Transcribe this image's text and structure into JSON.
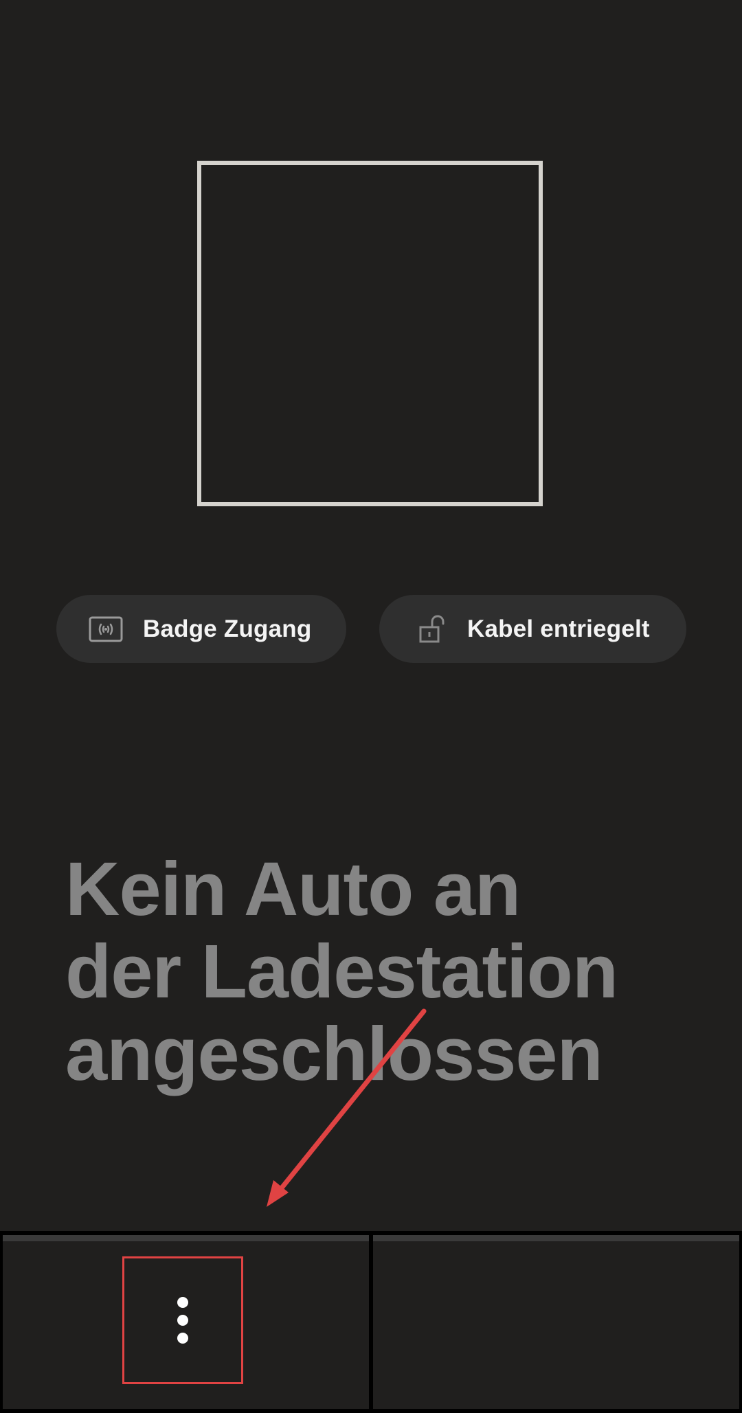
{
  "chips": {
    "badge": {
      "label": "Badge Zugang",
      "icon": "rfid-badge-icon"
    },
    "cable": {
      "label": "Kabel entriegelt",
      "icon": "unlocked-padlock-icon"
    }
  },
  "status": {
    "line1": "Kein Auto an",
    "line2": "der Ladestation",
    "line3": "angeschlossen"
  },
  "bottom_bar": {
    "more_icon": "vertical-ellipsis-icon"
  },
  "colors": {
    "background": "#201f1e",
    "frame": "#d5d3ce",
    "chip": "#2f2f2f",
    "status_text": "#858585",
    "annotation": "#e04343"
  }
}
